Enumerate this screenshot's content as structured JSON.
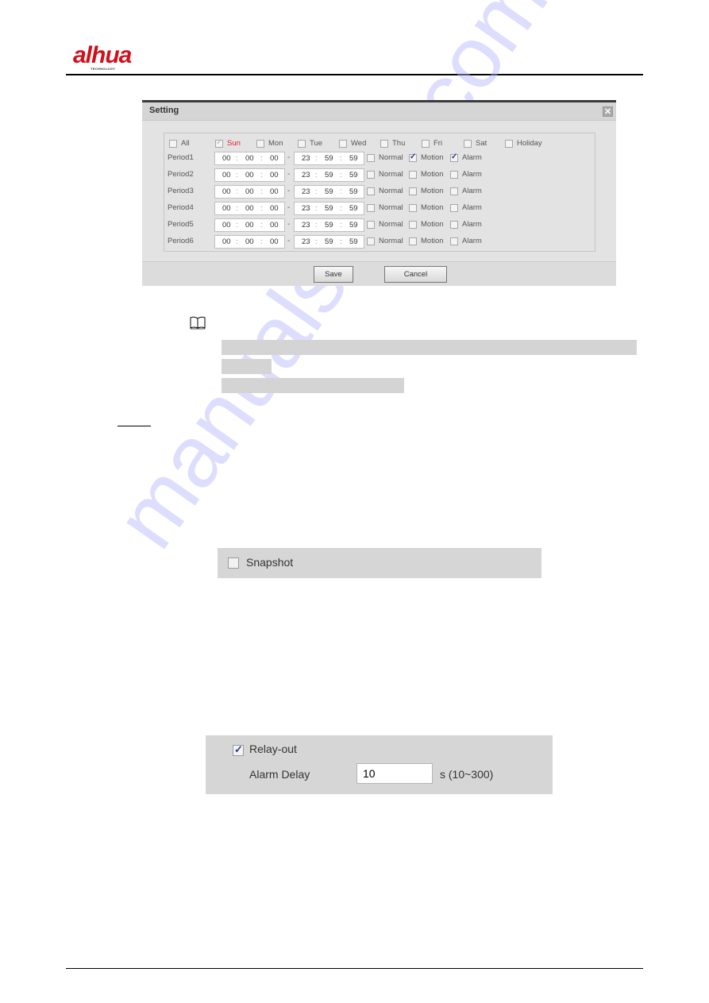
{
  "header": {
    "logo_text": "alhua",
    "logo_subtext": "TECHNOLOGY",
    "brand_color": "#d0101c"
  },
  "dialog": {
    "title": "Setting",
    "close_icon": "close-icon",
    "days": [
      {
        "label": "All",
        "checked": false,
        "disabled": false
      },
      {
        "label": "Sun",
        "checked": true,
        "disabled": true,
        "highlight": true
      },
      {
        "label": "Mon",
        "checked": false
      },
      {
        "label": "Tue",
        "checked": false
      },
      {
        "label": "Wed",
        "checked": false
      },
      {
        "label": "Thu",
        "checked": false
      },
      {
        "label": "Fri",
        "checked": false
      },
      {
        "label": "Sat",
        "checked": false
      },
      {
        "label": "Holiday",
        "checked": false
      }
    ],
    "periods": [
      {
        "label": "Period1",
        "start": [
          "00",
          "00",
          "00"
        ],
        "end": [
          "23",
          "59",
          "59"
        ],
        "normal": false,
        "motion": true,
        "alarm": true
      },
      {
        "label": "Period2",
        "start": [
          "00",
          "00",
          "00"
        ],
        "end": [
          "23",
          "59",
          "59"
        ],
        "normal": false,
        "motion": false,
        "alarm": false
      },
      {
        "label": "Period3",
        "start": [
          "00",
          "00",
          "00"
        ],
        "end": [
          "23",
          "59",
          "59"
        ],
        "normal": false,
        "motion": false,
        "alarm": false
      },
      {
        "label": "Period4",
        "start": [
          "00",
          "00",
          "00"
        ],
        "end": [
          "23",
          "59",
          "59"
        ],
        "normal": false,
        "motion": false,
        "alarm": false
      },
      {
        "label": "Period5",
        "start": [
          "00",
          "00",
          "00"
        ],
        "end": [
          "23",
          "59",
          "59"
        ],
        "normal": false,
        "motion": false,
        "alarm": false
      },
      {
        "label": "Period6",
        "start": [
          "00",
          "00",
          "00"
        ],
        "end": [
          "23",
          "59",
          "59"
        ],
        "normal": false,
        "motion": false,
        "alarm": false
      }
    ],
    "type_labels": {
      "normal": "Normal",
      "motion": "Motion",
      "alarm": "Alarm"
    },
    "time_separator": ":",
    "range_separator": "-",
    "save_label": "Save",
    "cancel_label": "Cancel"
  },
  "note": {
    "icon": "book-icon"
  },
  "snapshot": {
    "label": "Snapshot",
    "checked": false
  },
  "relay": {
    "label": "Relay-out",
    "checked": true,
    "delay_label": "Alarm Delay",
    "delay_value": "10",
    "delay_unit": "s (10~300)"
  },
  "watermark": "manualshive.com"
}
